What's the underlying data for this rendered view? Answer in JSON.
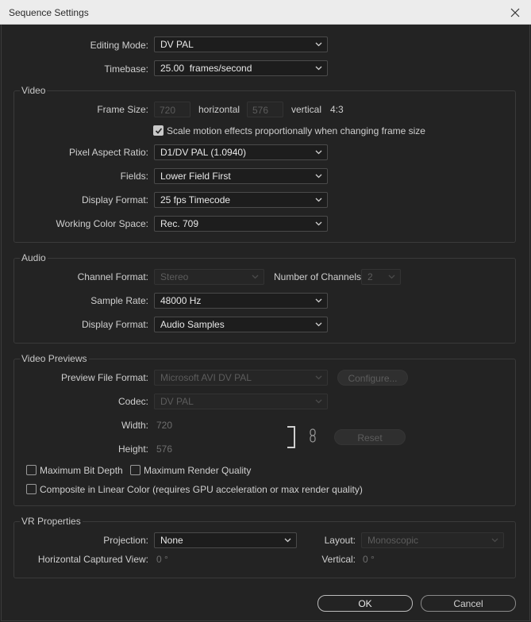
{
  "window": {
    "title": "Sequence Settings"
  },
  "general": {
    "editing_mode_label": "Editing Mode:",
    "editing_mode_value": "DV PAL",
    "timebase_label": "Timebase:",
    "timebase_value": "25.00  frames/second"
  },
  "video": {
    "group_title": "Video",
    "frame_size_label": "Frame Size:",
    "frame_width": "720",
    "horizontal_label": "horizontal",
    "frame_height": "576",
    "vertical_label": "vertical",
    "aspect": "4:3",
    "scale_motion_label": "Scale motion effects proportionally when changing frame size",
    "scale_motion_checked": true,
    "pixel_aspect_label": "Pixel Aspect Ratio:",
    "pixel_aspect_value": "D1/DV PAL (1.0940)",
    "fields_label": "Fields:",
    "fields_value": "Lower Field First",
    "display_format_label": "Display Format:",
    "display_format_value": "25 fps Timecode",
    "color_space_label": "Working Color Space:",
    "color_space_value": "Rec. 709"
  },
  "audio": {
    "group_title": "Audio",
    "channel_format_label": "Channel Format:",
    "channel_format_value": "Stereo",
    "num_channels_label": "Number of Channels:",
    "num_channels_value": "2",
    "sample_rate_label": "Sample Rate:",
    "sample_rate_value": "48000 Hz",
    "display_format_label": "Display Format:",
    "display_format_value": "Audio Samples"
  },
  "previews": {
    "group_title": "Video Previews",
    "file_format_label": "Preview File Format:",
    "file_format_value": "Microsoft AVI DV PAL",
    "configure_label": "Configure...",
    "codec_label": "Codec:",
    "codec_value": "DV PAL",
    "width_label": "Width:",
    "width_value": "720",
    "height_label": "Height:",
    "height_value": "576",
    "reset_label": "Reset",
    "max_bit_depth_label": "Maximum Bit Depth",
    "max_render_quality_label": "Maximum Render Quality",
    "linear_color_label": "Composite in Linear Color (requires GPU acceleration or max render quality)"
  },
  "vr": {
    "group_title": "VR Properties",
    "projection_label": "Projection:",
    "projection_value": "None",
    "layout_label": "Layout:",
    "layout_value": "Monoscopic",
    "h_view_label": "Horizontal Captured View:",
    "h_view_value": "0 °",
    "vertical_label": "Vertical:",
    "vertical_value": "0 °"
  },
  "buttons": {
    "ok": "OK",
    "cancel": "Cancel"
  },
  "colors": {
    "background": "#232323",
    "titlebar": "#ececec",
    "field": "#1d1d1d"
  },
  "icons": [
    "close-icon",
    "chevron-down-icon",
    "checkmark-icon",
    "link-chain-icon"
  ]
}
